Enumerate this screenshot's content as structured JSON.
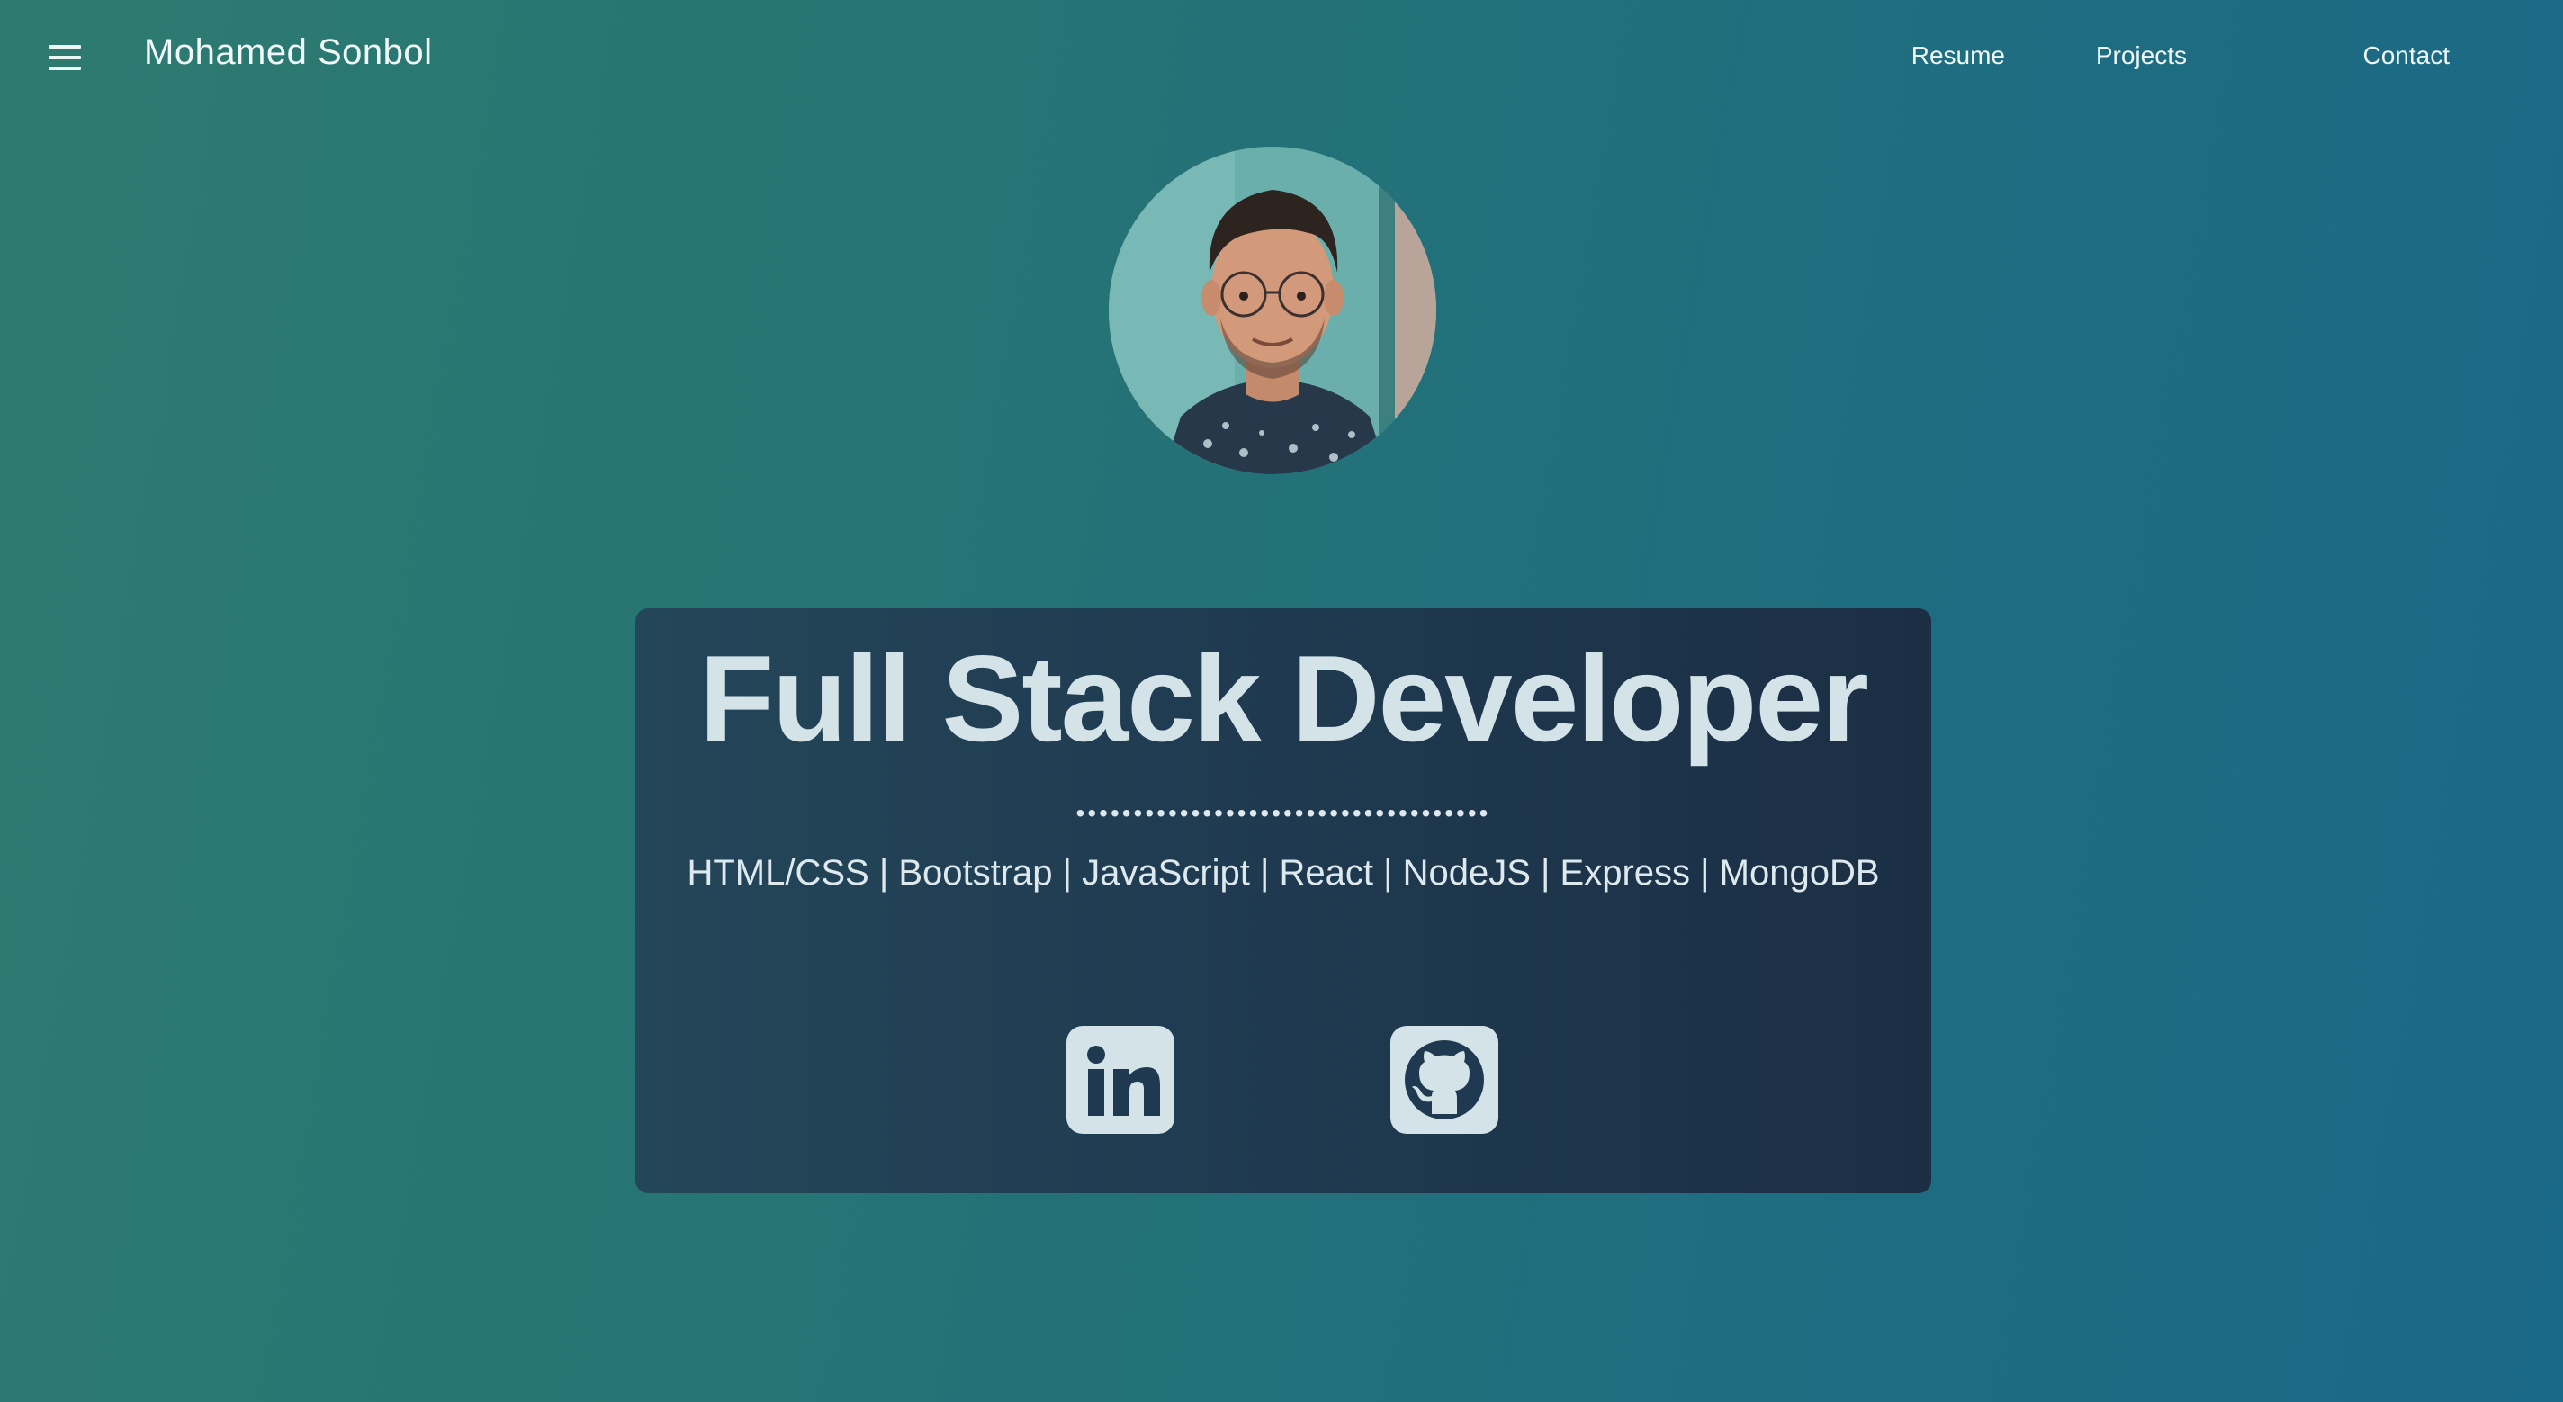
{
  "header": {
    "brand": "Mohamed Sonbol",
    "menu_icon": "hamburger-menu-icon",
    "nav": [
      {
        "label": "Resume"
      },
      {
        "label": "Projects"
      },
      {
        "label": "Contact"
      }
    ]
  },
  "hero": {
    "avatar_alt": "profile photo",
    "title": "Full Stack Developer",
    "divider": "••••••••••••••••••••••••••••••••••••",
    "skills": "HTML/CSS | Bootstrap | JavaScript | React | NodeJS | Express | MongoDB",
    "social": [
      {
        "icon": "linkedin-icon"
      },
      {
        "icon": "github-icon"
      }
    ]
  },
  "colors": {
    "card_bg": "#1f3a50",
    "text_light": "#d3e3e8",
    "gradient_start": "#2d7b70",
    "gradient_end": "#1a6887"
  }
}
